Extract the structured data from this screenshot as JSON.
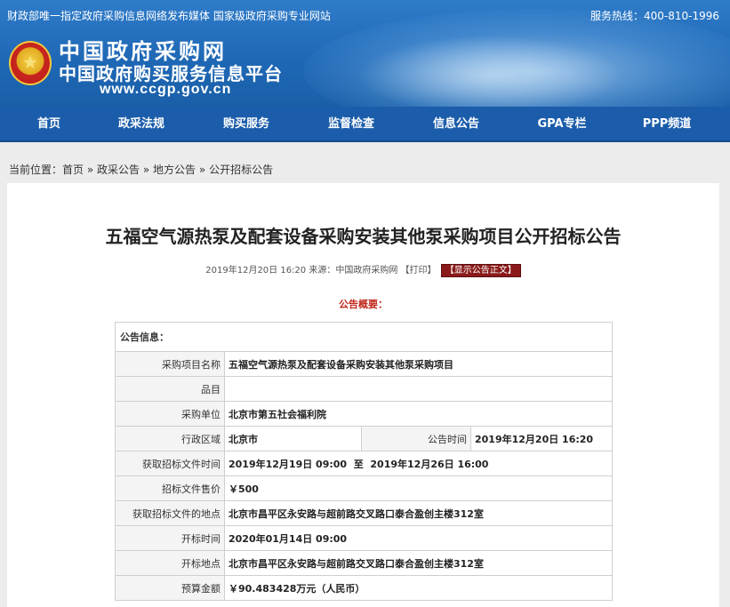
{
  "topbar": {
    "left_text": "财政部唯一指定政府采购信息网络发布媒体 国家级政府采购专业网站",
    "hotline": "服务热线：400-810-1996"
  },
  "logo": {
    "emblem_icon": "national-emblem-icon",
    "line1": "中国政府采购网",
    "line2": "中国政府购买服务信息平台",
    "url": "www.ccgp.gov.cn"
  },
  "nav": {
    "items": [
      {
        "label": "首页"
      },
      {
        "label": "政采法规"
      },
      {
        "label": "购买服务"
      },
      {
        "label": "监督检查"
      },
      {
        "label": "信息公告"
      },
      {
        "label": "GPA专栏"
      },
      {
        "label": "PPP频道"
      }
    ]
  },
  "breadcrumb": {
    "prefix": "当前位置：",
    "items": [
      "首页",
      "政采公告",
      "地方公告",
      "公开招标公告"
    ],
    "sep": "»"
  },
  "article": {
    "title": "五福空气源热泵及配套设备采购安装其他泵采购项目公开招标公告",
    "meta_datetime": "2019年12月20日 16:20",
    "meta_source": "来源：中国政府采购网",
    "print_label": "【打印】",
    "show_label": "【显示公告正文】",
    "summary_label": "公告概要："
  },
  "info_table": {
    "header": "公告信息：",
    "rows": {
      "project_name": {
        "label": "采购项目名称",
        "value": "五福空气源热泵及配套设备采购安装其他泵采购项目"
      },
      "item": {
        "label": "品目",
        "value": ""
      },
      "buyer": {
        "label": "采购单位",
        "value": "北京市第五社会福利院"
      },
      "region": {
        "label": "行政区域",
        "value": "北京市"
      },
      "publish_time": {
        "label": "公告时间",
        "value": "2019年12月20日 16:20"
      },
      "doc_time": {
        "label": "获取招标文件时间",
        "value": "2019年12月19日 09:00  至  2019年12月26日 16:00"
      },
      "doc_price": {
        "label": "招标文件售价",
        "value": "￥500"
      },
      "doc_place": {
        "label": "获取招标文件的地点",
        "value": "北京市昌平区永安路与超前路交叉路口泰合盈创主楼312室"
      },
      "open_time": {
        "label": "开标时间",
        "value": "2020年01月14日 09:00"
      },
      "open_place": {
        "label": "开标地点",
        "value": "北京市昌平区永安路与超前路交叉路口泰合盈创主楼312室"
      },
      "budget": {
        "label": "预算金额",
        "value": "￥90.483428万元（人民币）"
      }
    }
  },
  "colors": {
    "banner": "#1f68b6",
    "nav": "#1b5daa",
    "accent_red": "#c0271b",
    "button_dark_red": "#8a1a1a"
  }
}
